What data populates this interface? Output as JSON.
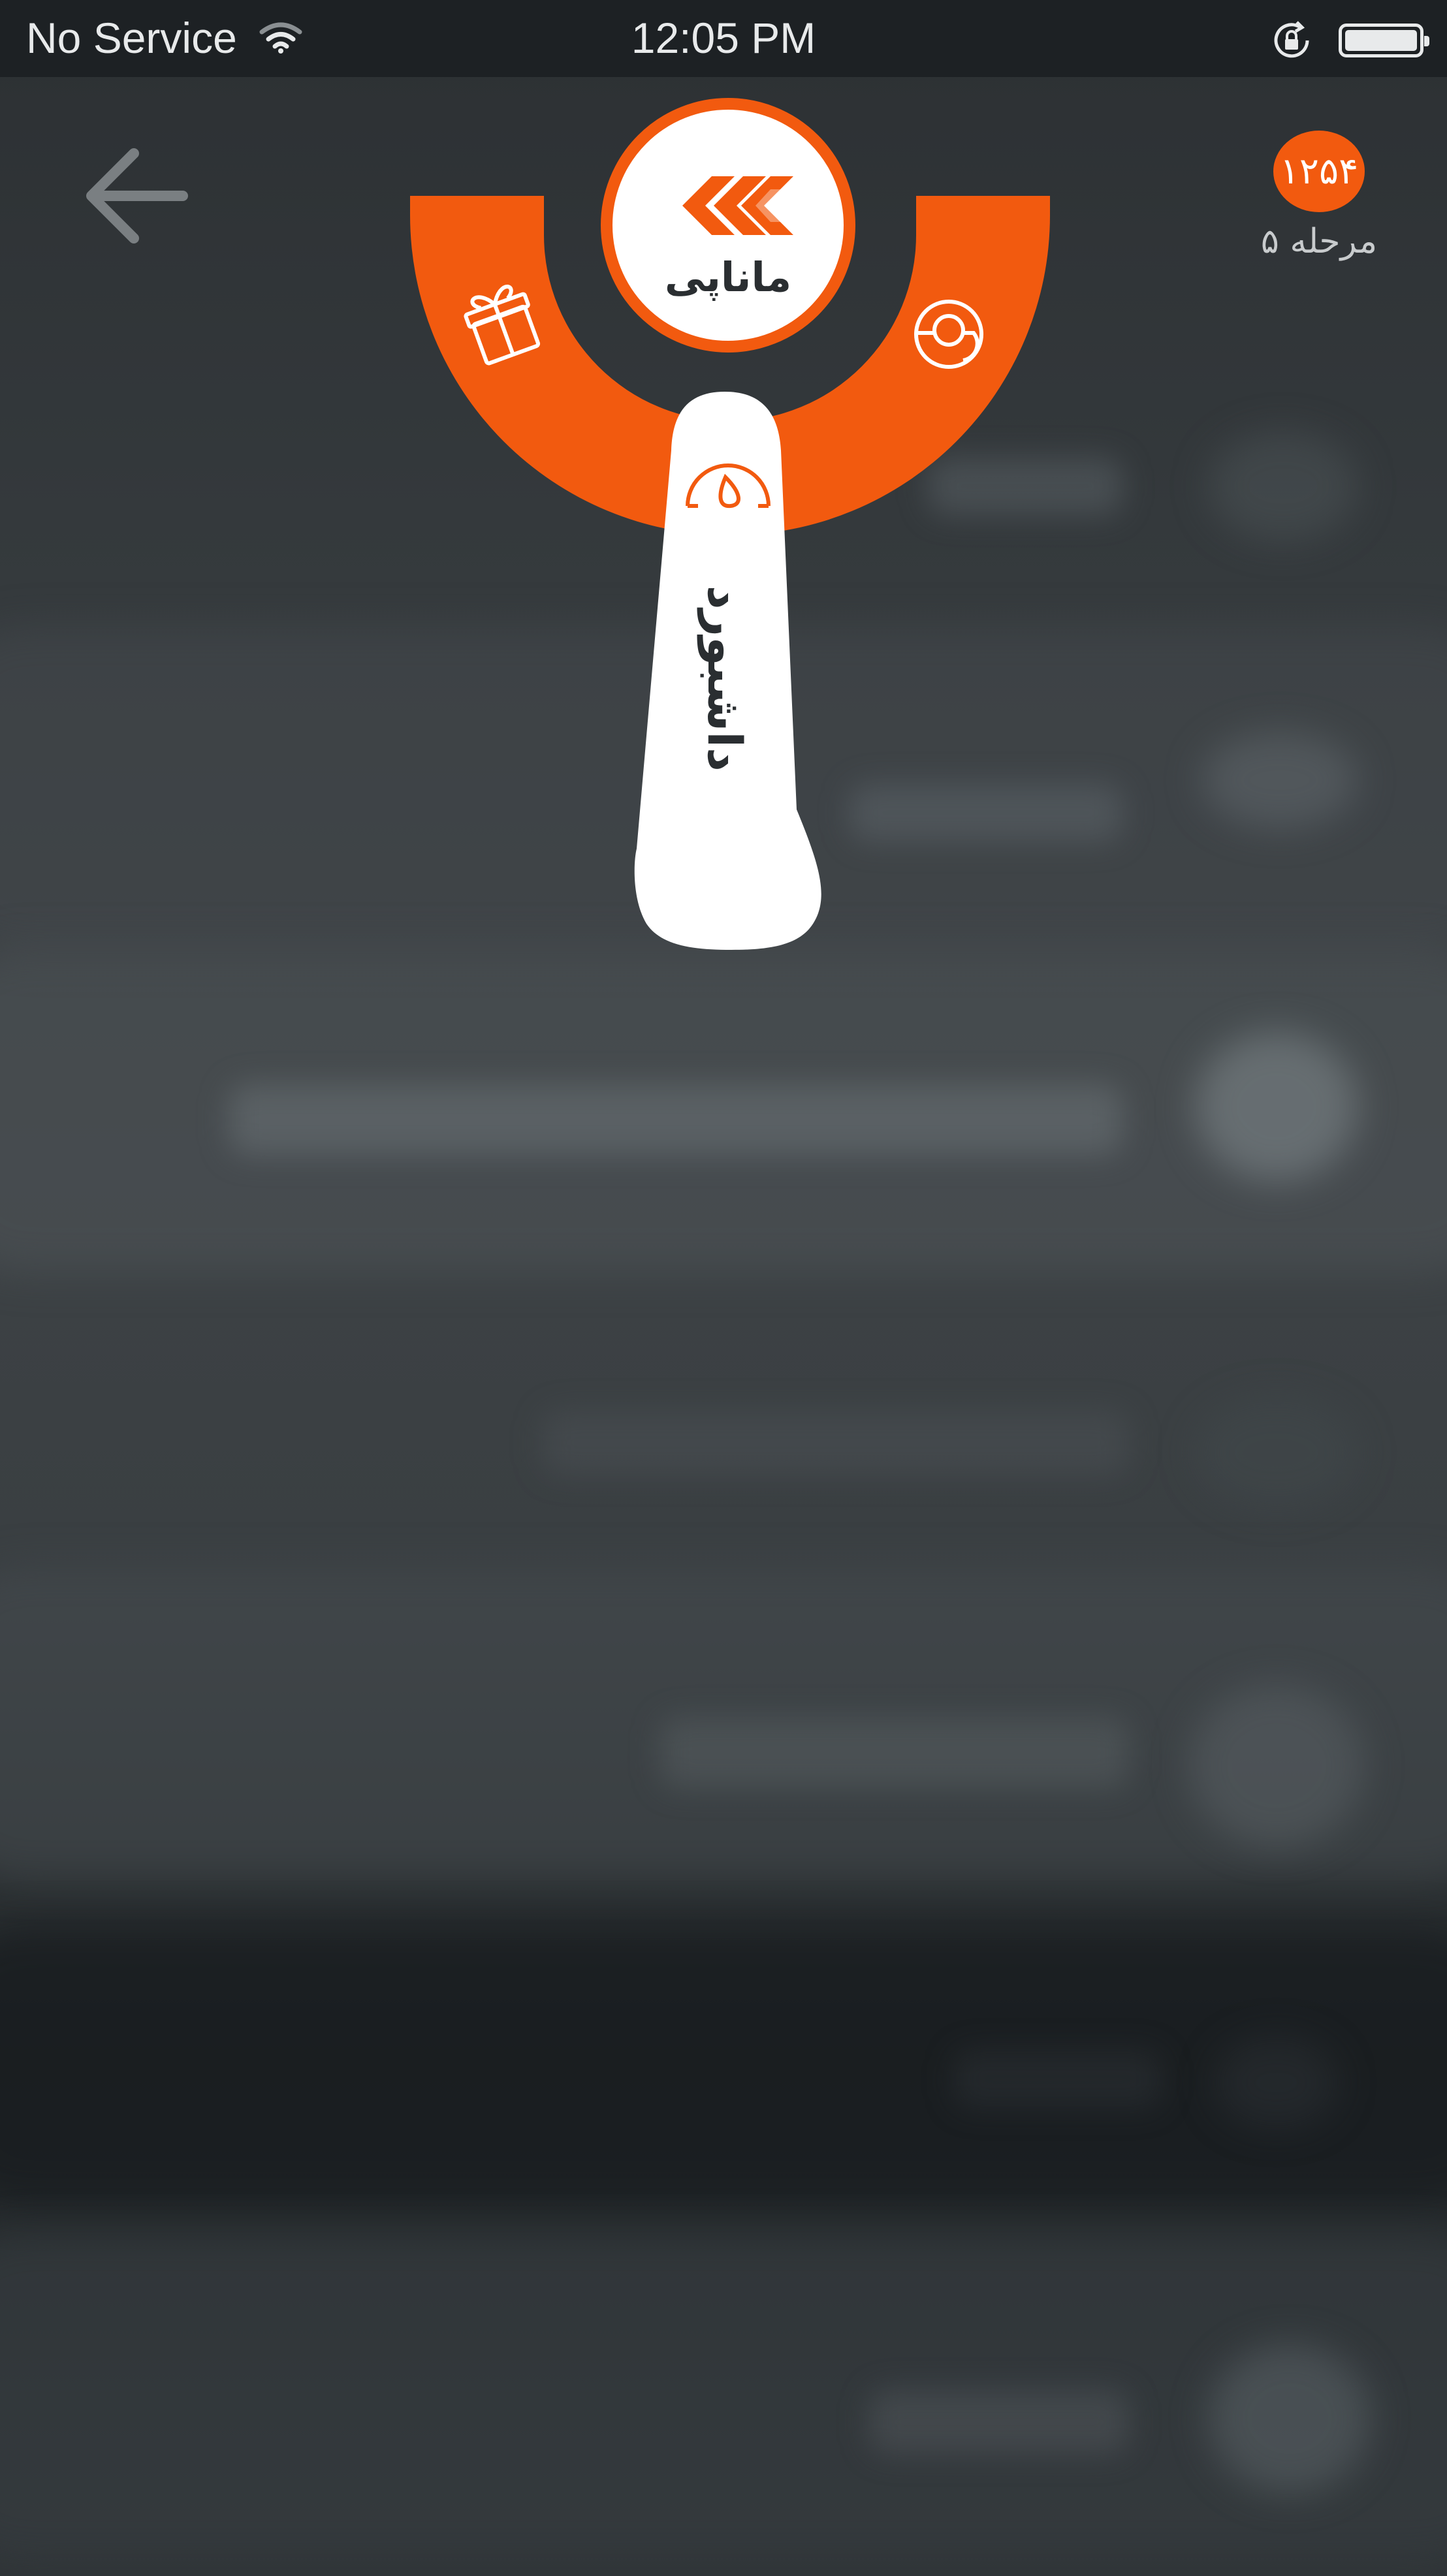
{
  "status_bar": {
    "carrier": "No Service",
    "time": "12:05 PM"
  },
  "header": {
    "level_badge": "۱۲۵۴",
    "level_label": "مرحله ۵"
  },
  "radial_menu": {
    "center_title": "ماناپی",
    "active_item_label": "داشبورد",
    "accent_color": "#f25a0f",
    "items": [
      {
        "icon": "gift-icon"
      },
      {
        "icon": "dashboard-gauge-icon"
      },
      {
        "icon": "chart-pie-icon"
      }
    ]
  }
}
